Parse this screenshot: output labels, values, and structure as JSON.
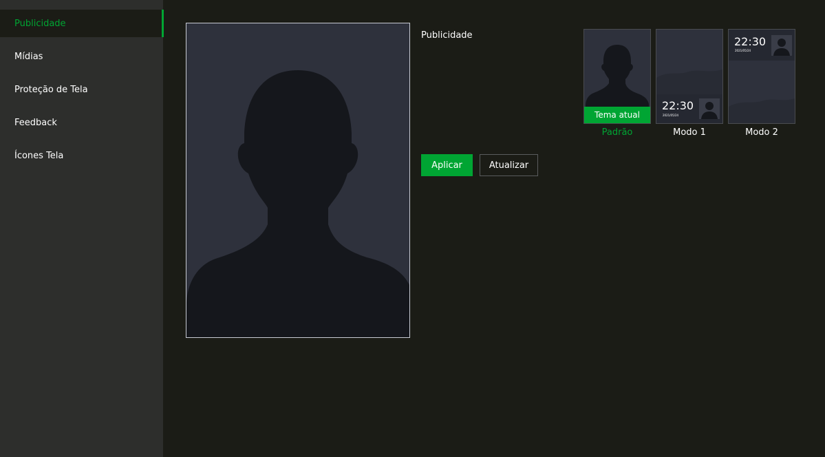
{
  "sidebar": {
    "items": [
      {
        "label": "Publicidade",
        "active": true
      },
      {
        "label": "Mídias",
        "active": false
      },
      {
        "label": "Proteção de Tela",
        "active": false
      },
      {
        "label": "Feedback",
        "active": false
      },
      {
        "label": "Ícones Tela",
        "active": false
      }
    ]
  },
  "main": {
    "section_title": "Publicidade",
    "themes": [
      {
        "name": "Padrão",
        "badge": "Tema atual",
        "current": true
      },
      {
        "name": "Modo 1",
        "clock": "22:30",
        "date": "2021/05/24"
      },
      {
        "name": "Modo 2",
        "clock": "22:30",
        "date": "2021/05/24"
      }
    ],
    "buttons": {
      "apply": "Aplicar",
      "refresh": "Atualizar"
    }
  },
  "colors": {
    "accent": "#00a533",
    "sidebar_bg": "#2d2e2c",
    "main_bg": "#1b1c16",
    "preview_bg": "#2e313c",
    "silhouette": "#15171c"
  },
  "icons": {
    "preview": "person-silhouette-icon"
  }
}
